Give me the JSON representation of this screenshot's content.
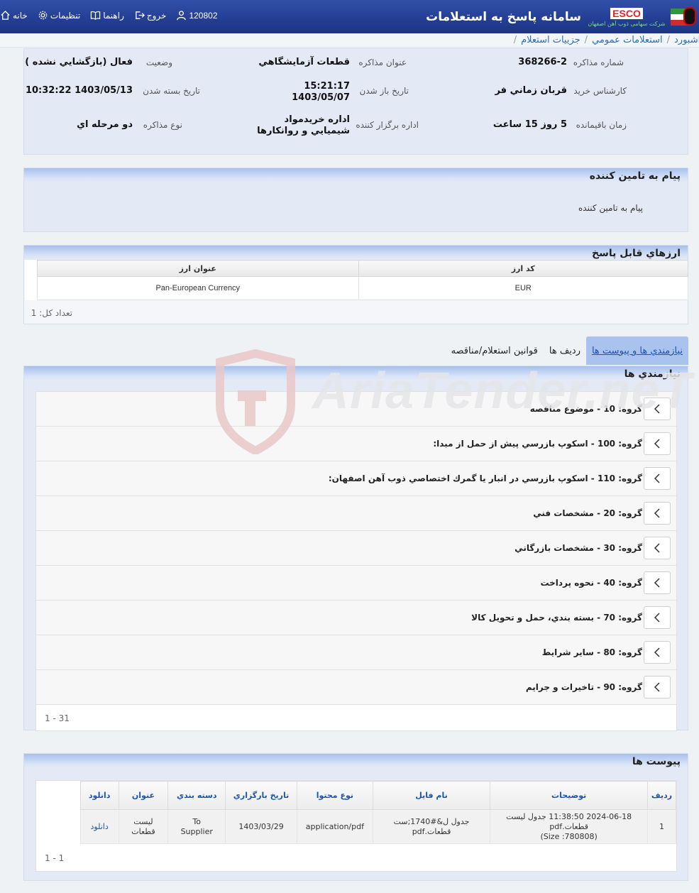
{
  "header": {
    "app_title": "سامانه پاسخ به استعلامات",
    "brand_code": "ESCO",
    "brand_sub": "شرکت سهامی ذوب آهن اصفهان",
    "nav": {
      "home": "خانه",
      "settings": "تنظیمات",
      "help": "راهنما",
      "logout": "خروج",
      "user_id": "120802"
    }
  },
  "breadcrumb": [
    "داشبورد",
    "استعلامات عمومي",
    "جزييات استعلام"
  ],
  "info": {
    "row1": {
      "number_label": "شماره مذاکره",
      "number_value": "368266-2",
      "title_label": "عنوان مذاکره",
      "title_value": "قطعات آزمايشگاهي",
      "status_label": "وضعيت",
      "status_value": "فعال (بازگشايي نشده )"
    },
    "row2": {
      "expert_label": "کارشناس خريد",
      "expert_value": "قربان زماني فر",
      "open_label": "تاريخ باز شدن",
      "open_time": "15:21:17",
      "open_date": "1403/05/07",
      "close_label": "تاريخ بسته شدن",
      "close_value": "1403/05/13 10:32:22"
    },
    "row3": {
      "remaining_label": "زمان باقيمانده",
      "remaining_value": "5 روز 15 ساعت",
      "org_label": "اداره برگزار كننده",
      "org_line1": "اداره خريدمواد",
      "org_line2": "شيميايي و روانكارها",
      "type_label": "نوع مذاکره",
      "type_value": "دو مرحله اي"
    }
  },
  "supplier_message": {
    "heading": "پيام به تامين کننده",
    "body": "پيام به تامين کننده"
  },
  "currencies": {
    "heading": "ارزهاي قابل پاسخ",
    "columns": [
      "کد ارز",
      "عنوان ارز"
    ],
    "rows": [
      [
        "EUR",
        "Pan-European Currency"
      ]
    ],
    "total": "تعداد کل: 1"
  },
  "tabs": [
    "نيازمندي ها و پيوست ها",
    "رديف ها",
    "قوانين استعلام/مناقصه"
  ],
  "needs": {
    "heading": "نيازمندي ها",
    "groups": [
      "گروه: 10 - موضوع مناقصه",
      "گروه: 100 - اسکوپ بازرسي پيش از حمل از مبدا:",
      "گروه: 110 - اسکوپ بازرسي در انبار يا گمرك اختصاصي ذوب آهن اصفهان:",
      "گروه: 20 - مشخصات فني",
      "گروه: 30 - مشخصات بازرگاني",
      "گروه: 40 - نحوه پرداخت",
      "گروه: 70 - بسته بندي، حمل و تحويل کالا",
      "گروه: 80 - ساير شرايط",
      "گروه: 90 - تاخيرات و جرايم"
    ],
    "pager": "1 - 31"
  },
  "attachments": {
    "heading": "پيوست ها",
    "columns": [
      "رديف",
      "توضيحات",
      "نام فايل",
      "نوع محتوا",
      "تاريخ بارگزاري",
      "دسته بندي",
      "عنوان",
      "دانلود"
    ],
    "rows": [
      {
        "row": "1",
        "desc_line1": "2024-06-18 11:38:50 جدول ليست قطعات.pdf",
        "desc_line2": "(Size :780808)",
        "file_line1": "جدول ل&#1740;ست",
        "file_line2": "قطعات.pdf",
        "content_type": "application/pdf",
        "upload_date": "1403/03/29",
        "category_line1": "To",
        "category_line2": "Supplier",
        "title_line1": "ليست",
        "title_line2": "قطعات",
        "download": "دانلود"
      }
    ],
    "pager": "1 - 1"
  },
  "watermark": "AriaTender.neT",
  "colors": {
    "header_blue": "#243f95",
    "link_blue": "#1a55b3",
    "panel_bg": "#e4e9f6",
    "brand_red": "#e52222"
  }
}
